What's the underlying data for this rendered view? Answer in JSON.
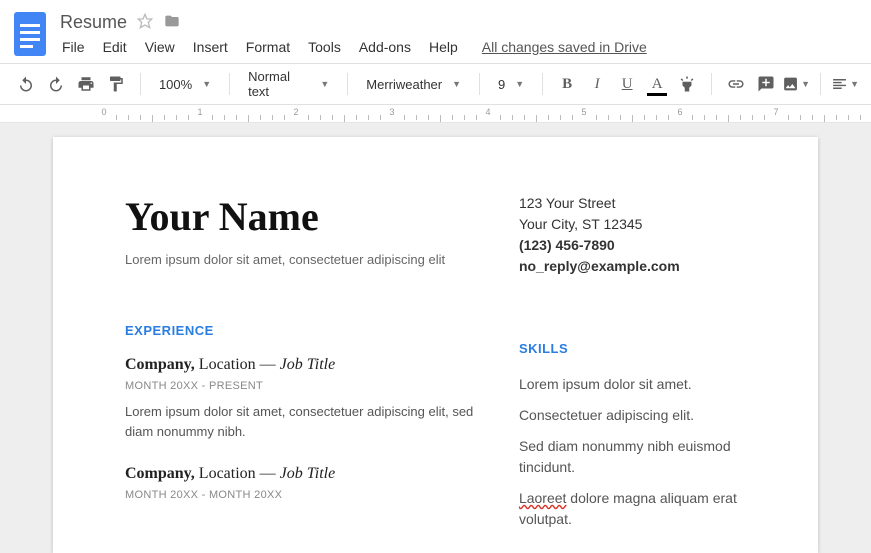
{
  "header": {
    "title": "Resume",
    "menus": [
      "File",
      "Edit",
      "View",
      "Insert",
      "Format",
      "Tools",
      "Add-ons",
      "Help"
    ],
    "save_status": "All changes saved in Drive"
  },
  "toolbar": {
    "zoom": "100%",
    "style": "Normal text",
    "font": "Merriweather",
    "size": "9",
    "bold": "B",
    "italic": "I",
    "underline": "U",
    "textcolor": "A"
  },
  "document": {
    "name": "Your Name",
    "tagline": "Lorem ipsum dolor sit amet, consectetuer adipiscing elit",
    "address": {
      "street": "123 Your Street",
      "city": "Your City, ST 12345",
      "phone": "(123) 456-7890",
      "email": "no_reply@example.com"
    },
    "experience_h": "EXPERIENCE",
    "skills_h": "SKILLS",
    "jobs": [
      {
        "company": "Company,",
        "location": "Location",
        "sep": "—",
        "role": "Job Title",
        "dates": "MONTH 20XX - PRESENT",
        "desc": "Lorem ipsum dolor sit amet, consectetuer adipiscing elit, sed diam nonummy nibh."
      },
      {
        "company": "Company,",
        "location": "Location",
        "sep": "—",
        "role": "Job Title",
        "dates": "MONTH 20XX - MONTH 20XX",
        "desc": ""
      }
    ],
    "skills": [
      "Lorem ipsum dolor sit amet.",
      "Consectetuer adipiscing elit.",
      "Sed diam nonummy nibh euismod tincidunt."
    ],
    "skill_err_pre": "Laoreet",
    "skill_err_post": " dolore magna aliquam erat volutpat."
  }
}
